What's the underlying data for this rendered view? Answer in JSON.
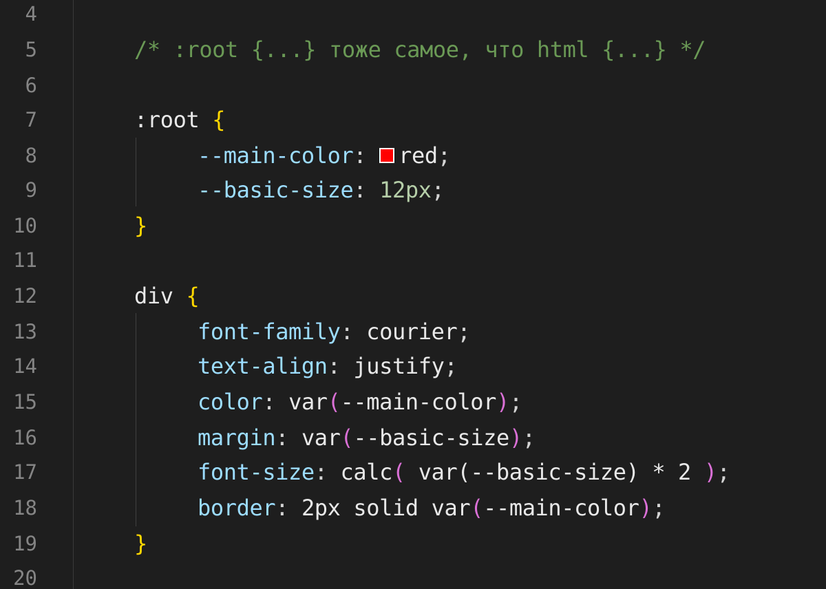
{
  "editor": {
    "lines": [
      {
        "num": "4"
      },
      {
        "num": "5",
        "comment": "/* :root {...} тоже самое, что html {...} */"
      },
      {
        "num": "6"
      },
      {
        "num": "7",
        "selector": ":root",
        "brace": "{"
      },
      {
        "num": "8",
        "prop": "--main-color",
        "colon": ": ",
        "value": "red",
        "semi": ";",
        "swatch_color": "#ff0000"
      },
      {
        "num": "9",
        "prop": "--basic-size",
        "colon": ": ",
        "value": "12px",
        "semi": ";"
      },
      {
        "num": "10",
        "brace": "}"
      },
      {
        "num": "11"
      },
      {
        "num": "12",
        "selector": "div",
        "brace": "{"
      },
      {
        "num": "13",
        "prop": "font-family",
        "colon": ": ",
        "value": "courier",
        "semi": ";"
      },
      {
        "num": "14",
        "prop": "text-align",
        "colon": ": ",
        "value": "justify",
        "semi": ";"
      },
      {
        "num": "15",
        "prop": "color",
        "colon": ": ",
        "func": "var",
        "open": "(",
        "arg": "--main-color",
        "close": ")",
        "semi": ";"
      },
      {
        "num": "16",
        "prop": "margin",
        "colon": ": ",
        "func": "var",
        "open": "(",
        "arg": "--basic-size",
        "close": ")",
        "semi": ";"
      },
      {
        "num": "17",
        "prop": "font-size",
        "colon": ": ",
        "func": "calc",
        "open": "(",
        "inner": " var(--basic-size) * 2 ",
        "close": ")",
        "semi": ";"
      },
      {
        "num": "18",
        "prop": "border",
        "colon": ": ",
        "prefix": "2px solid ",
        "func": "var",
        "open": "(",
        "arg": "--main-color",
        "close": ")",
        "semi": ";"
      },
      {
        "num": "19",
        "brace": "}"
      },
      {
        "num": "20"
      }
    ]
  },
  "colors": {
    "background": "#1e1e1e",
    "line_number": "#858585",
    "comment": "#6a9955",
    "property": "#9cdcfe",
    "brace": "#ffd700",
    "paren": "#da70d6"
  }
}
